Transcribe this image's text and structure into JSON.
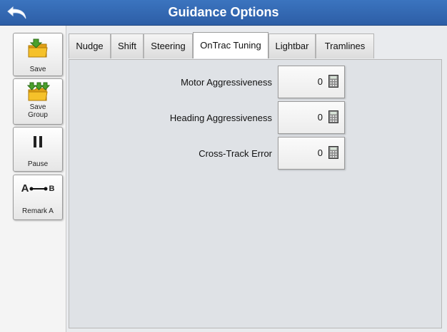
{
  "title": "Guidance Options",
  "side_buttons": {
    "save": "Save",
    "save_group_1": "Save",
    "save_group_2": "Group",
    "pause": "Pause",
    "remark_a": "Remark A",
    "ab_a": "A",
    "ab_b": "B"
  },
  "tabs": [
    "Nudge",
    "Shift",
    "Steering",
    "OnTrac Tuning",
    "Lightbar",
    "Tramlines"
  ],
  "active_tab": "OnTrac Tuning",
  "settings": [
    {
      "label": "Motor Aggressiveness",
      "value": "0"
    },
    {
      "label": "Heading Aggressiveness",
      "value": "0"
    },
    {
      "label": "Cross-Track Error",
      "value": "0"
    }
  ],
  "icons": {
    "back": "back-arrow-icon",
    "save": "folder-save-icon",
    "save_group": "folder-save-group-icon",
    "pause": "pause-icon",
    "remark": "ab-line-icon",
    "calculator": "calculator-icon"
  },
  "colors": {
    "titlebar": "#2d5ea6",
    "accent_green": "#4aa02c",
    "folder_yellow": "#f2b51d"
  }
}
